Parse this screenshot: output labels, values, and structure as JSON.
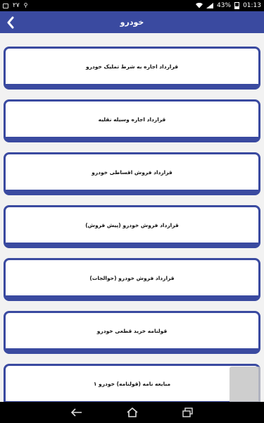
{
  "status_bar": {
    "left_number": "۲۷",
    "battery": "43%",
    "time": "01:13"
  },
  "app_bar": {
    "title": "خودرو"
  },
  "items": [
    {
      "label": "قرارداد اجاره به شرط تملیک خودرو"
    },
    {
      "label": "قرارداد اجاره وسیله نقلیه"
    },
    {
      "label": "قرارداد فروش اقساطی خودرو"
    },
    {
      "label": "قرارداد فروش خودرو (پیش فروش)"
    },
    {
      "label": "قرارداد فروش خودرو (حوالجات)"
    },
    {
      "label": "قولنامه خرید قطعی خودرو"
    },
    {
      "label": "مبایعه نامه (قولنامه) خودرو ۱"
    }
  ],
  "colors": {
    "primary": "#3a4aa0",
    "background": "#f2f2f2"
  }
}
